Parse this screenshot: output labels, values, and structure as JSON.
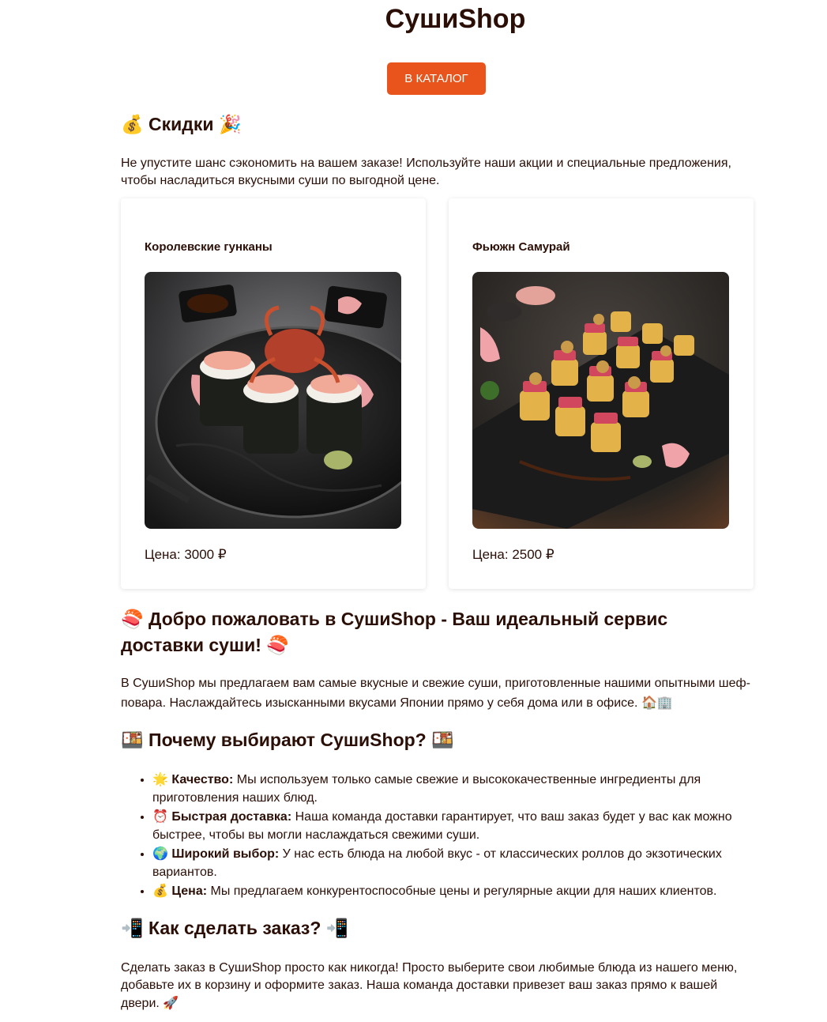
{
  "header": {
    "title": "СушиShop",
    "catalog_button": "В КАТАЛОГ"
  },
  "discounts": {
    "icon_left": "💰",
    "heading": "Скидки",
    "icon_right": "🎉",
    "text": "Не упустите шанс сэкономить на вашем заказе! Используйте наши акции и специальные предложения, чтобы насладиться вкусными суши по выгодной цене."
  },
  "products": [
    {
      "name": "Королевские гунканы",
      "price": "Цена: 3000 ₽",
      "image_icon": "gunkan-sushi-photo"
    },
    {
      "name": "Фьюжн Самурай",
      "price": "Цена: 2500 ₽",
      "image_icon": "fusion-roll-photo"
    }
  ],
  "welcome": {
    "icon_left": "🍣",
    "heading": "Добро пожаловать в СушиShop - Ваш идеальный сервис доставки суши!",
    "icon_right": "🍣",
    "text": "В СушиShop мы предлагаем вам самые вкусные и свежие суши, приготовленные нашими опытными шеф-повара. Наслаждайтесь изысканными вкусами Японии прямо у себя дома или в офисе.",
    "text_icons": "🏠🏢"
  },
  "why": {
    "icon_left": "🍱",
    "heading": "Почему выбирают СушиShop?",
    "icon_right": "🍱",
    "items": [
      {
        "icon": "🌟",
        "title": "Качество:",
        "text": "Мы используем только самые свежие и высококачественные ингредиенты для приготовления наших блюд."
      },
      {
        "icon": "⏰",
        "title": "Быстрая доставка:",
        "text": "Наша команда доставки гарантирует, что ваш заказ будет у вас как можно быстрее, чтобы вы могли наслаждаться свежими суши."
      },
      {
        "icon": "🌍",
        "title": "Широкий выбор:",
        "text": "У нас есть блюда на любой вкус - от классических роллов до экзотических вариантов."
      },
      {
        "icon": "💰",
        "title": "Цена:",
        "text": "Мы предлагаем конкурентоспособные цены и регулярные акции для наших клиентов."
      }
    ]
  },
  "order": {
    "icon_left": "📲",
    "heading": "Как сделать заказ?",
    "icon_right": "📲",
    "text": "Сделать заказ в СушиShop просто как никогда! Просто выберите свои любимые блюда из нашего меню, добавьте их в корзину и оформите заказ. Наша команда доставки привезет ваш заказ прямо к вашей двери.",
    "text_icon": "🚀"
  },
  "colors": {
    "accent": "#e8541c",
    "text": "#2b0f06"
  }
}
